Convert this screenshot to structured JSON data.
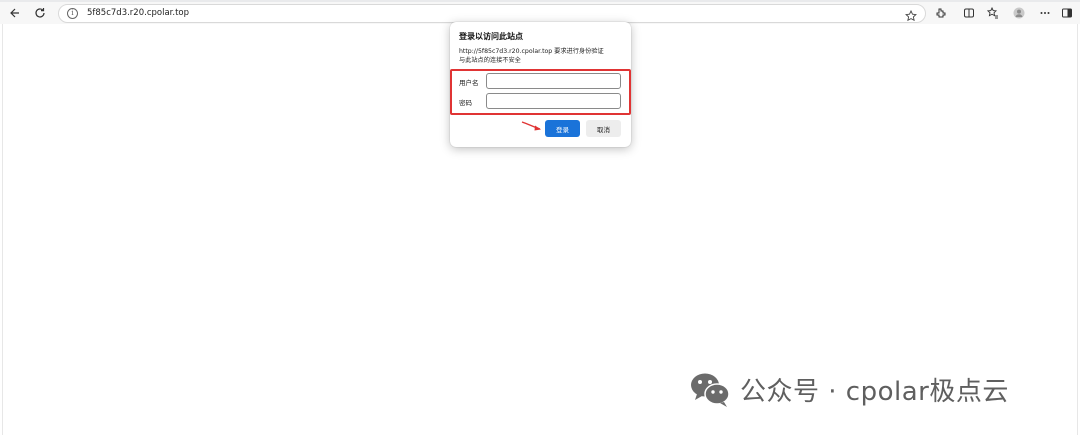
{
  "browser": {
    "url": "5f85c7d3.r20.cpolar.top",
    "icons": [
      "back-icon",
      "reload-icon",
      "site-info-icon",
      "favorite-star-icon",
      "extensions-icon",
      "split-screen-icon",
      "favorites-icon",
      "profile-icon",
      "more-icon",
      "sidebar-icon"
    ]
  },
  "dialog": {
    "title": "登录以访问此站点",
    "desc_line1": "http://5f85c7d3.r20.cpolar.top 要求进行身份验证",
    "desc_line2": "与此站点的连接不安全",
    "username_label": "用户名",
    "username_value": "",
    "password_label": "密码",
    "password_value": "",
    "login_label": "登录",
    "cancel_label": "取消"
  },
  "annotation": {
    "highlight_color": "#e03434",
    "arrow_color": "#e03434"
  },
  "watermark": {
    "text": "公众号 · cpolar极点云"
  },
  "colors": {
    "primary_button": "#1a73d9",
    "secondary_button": "#ededed",
    "toolbar_bg": "#f7f7f7"
  }
}
